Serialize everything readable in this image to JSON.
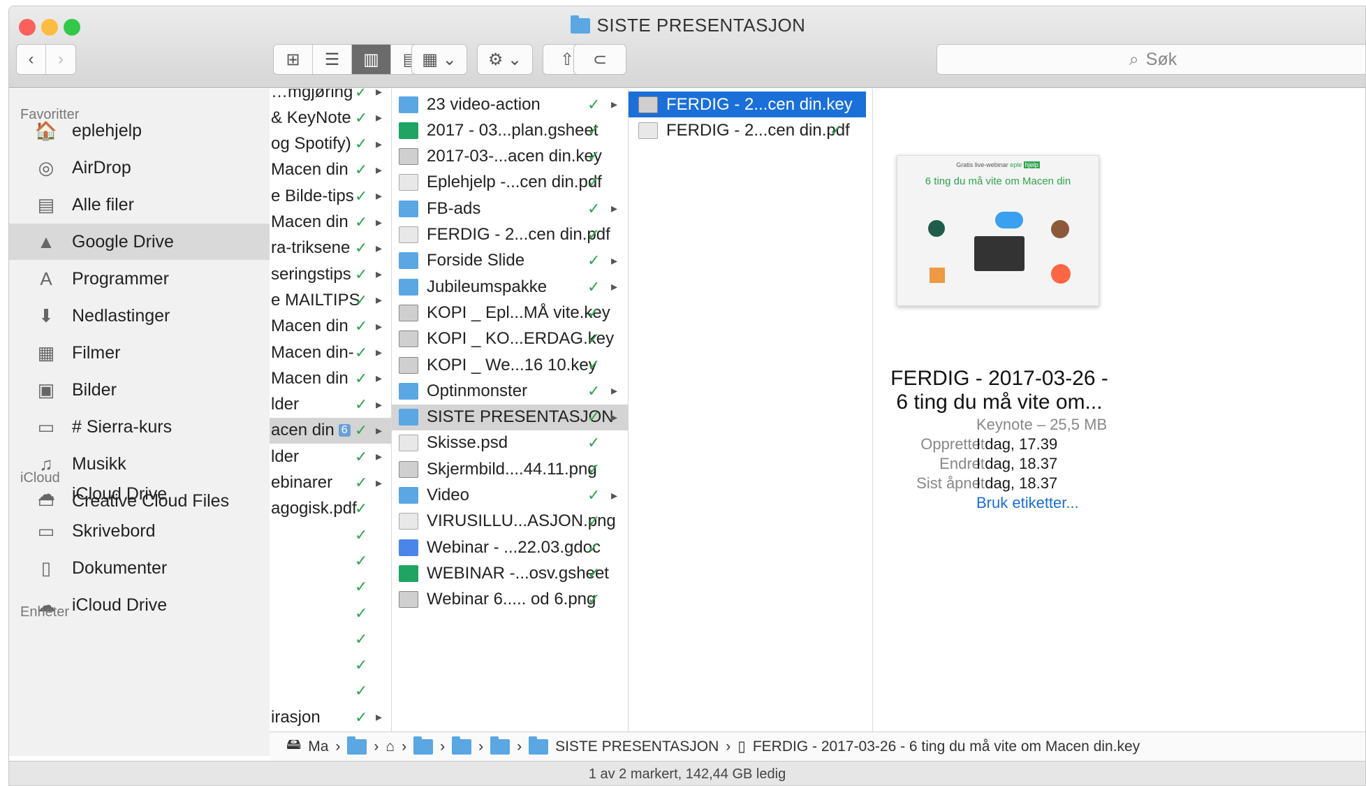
{
  "window": {
    "title": "SISTE PRESENTASJON"
  },
  "toolbar": {
    "back": "‹",
    "forward": "›",
    "view_icons": "⊞",
    "view_list": "☰",
    "view_columns": "▥",
    "view_gallery": "▤",
    "group": "▦ ⌄",
    "action": "⚙ ⌄",
    "share": "⇧",
    "tags": "⊂",
    "search_placeholder": "Søk"
  },
  "sidebar": {
    "favorites_header": "Favoritter",
    "favorites": [
      {
        "label": "eplehjelp",
        "icon": "🏠"
      },
      {
        "label": "AirDrop",
        "icon": "◎"
      },
      {
        "label": "Alle filer",
        "icon": "▤"
      },
      {
        "label": "Google Drive",
        "icon": "▲"
      },
      {
        "label": "Programmer",
        "icon": "A"
      },
      {
        "label": "Nedlastinger",
        "icon": "⬇"
      },
      {
        "label": "Filmer",
        "icon": "▦"
      },
      {
        "label": "Bilder",
        "icon": "▣"
      },
      {
        "label": "# Sierra-kurs",
        "icon": "▭"
      },
      {
        "label": "Musikk",
        "icon": "♫"
      },
      {
        "label": "Creative Cloud Files",
        "icon": "▭"
      }
    ],
    "icloud_header": "iCloud",
    "icloud": [
      {
        "label": "iCloud Drive",
        "icon": "☁"
      },
      {
        "label": "Skrivebord",
        "icon": "▭"
      },
      {
        "label": "Dokumenter",
        "icon": "▯"
      },
      {
        "label": "iCloud Drive",
        "icon": "☁"
      }
    ],
    "devices_header": "Enheter"
  },
  "column1": [
    "…mgjøring",
    "& KeyNote",
    "og Spotify)",
    "Macen din",
    "e Bilde-tips",
    "Macen din",
    "ra-triksene",
    "seringstips",
    "e MAILTIPS",
    "Macen din",
    "Macen din-",
    "Macen din",
    "lder",
    "acen din",
    "lder",
    "ebinarer",
    "agogisk.pdf",
    "",
    "",
    "",
    "",
    "",
    "",
    "",
    "irasjon"
  ],
  "column2": [
    {
      "name": "23 video-action",
      "type": "folder",
      "arrow": true
    },
    {
      "name": "2017 - 03...plan.gsheet",
      "type": "sheet",
      "arrow": false
    },
    {
      "name": "2017-03-...acen din.key",
      "type": "key",
      "arrow": false
    },
    {
      "name": "Eplehjelp -...cen din.pdf",
      "type": "file",
      "arrow": false
    },
    {
      "name": "FB-ads",
      "type": "folder",
      "arrow": true
    },
    {
      "name": "FERDIG - 2...cen din.pdf",
      "type": "file",
      "arrow": false
    },
    {
      "name": "Forside Slide",
      "type": "folder",
      "arrow": true
    },
    {
      "name": "Jubileumspakke",
      "type": "folder",
      "arrow": true
    },
    {
      "name": "KOPI _ Epl...MÅ vite.key",
      "type": "key",
      "arrow": false
    },
    {
      "name": "KOPI _ KO...ERDAG.key",
      "type": "key",
      "arrow": false
    },
    {
      "name": "KOPI _ We...16 10.key",
      "type": "key",
      "arrow": false
    },
    {
      "name": "Optinmonster",
      "type": "folder",
      "arrow": true
    },
    {
      "name": "SISTE PRESENTASJON",
      "type": "folder",
      "arrow": true
    },
    {
      "name": "Skisse.psd",
      "type": "file",
      "arrow": false
    },
    {
      "name": "Skjermbild....44.11.png",
      "type": "key",
      "arrow": false
    },
    {
      "name": "Video",
      "type": "folder",
      "arrow": true
    },
    {
      "name": "VIRUSILLU...ASJON.png",
      "type": "file",
      "arrow": false
    },
    {
      "name": "Webinar - ...22.03.gdoc",
      "type": "doc",
      "arrow": false
    },
    {
      "name": "WEBINAR -...osv.gsheet",
      "type": "sheet",
      "arrow": false
    },
    {
      "name": "Webinar 6..... od 6.png",
      "type": "key",
      "arrow": false
    }
  ],
  "column3": [
    {
      "name": "FERDIG - 2...cen din.key",
      "type": "key"
    },
    {
      "name": "FERDIG - 2...cen din.pdf",
      "type": "file"
    }
  ],
  "preview": {
    "thumb_small": "Gratis live-webinar",
    "thumb_brand": "eple",
    "thumb_brand_tag": "hjelp",
    "thumb_title": "6 ting du må vite om Macen din",
    "name_line1": "FERDIG - 2017-03-26 -",
    "name_line2": "6 ting du må vite om...",
    "kind": "Keynote – 25,5 MB",
    "created_label": "Opprettet",
    "created_value": "I dag, 17.39",
    "modified_label": "Endret",
    "modified_value": "I dag, 18.37",
    "opened_label": "Sist åpnet",
    "opened_value": "I dag, 18.37",
    "tags_link": "Bruk etiketter..."
  },
  "pathbar": {
    "root": "Ma",
    "current_folder": "SISTE PRESENTASJON",
    "file": "FERDIG - 2017-03-26 - 6 ting du må vite om Macen din.key"
  },
  "status": {
    "text": "1 av 2 markert, 142,44 GB ledig"
  },
  "badge": {
    "count": "6"
  },
  "colors": {
    "accent": "#1a6fd8",
    "check": "#2ea44f",
    "folder": "#5aa7e4"
  }
}
